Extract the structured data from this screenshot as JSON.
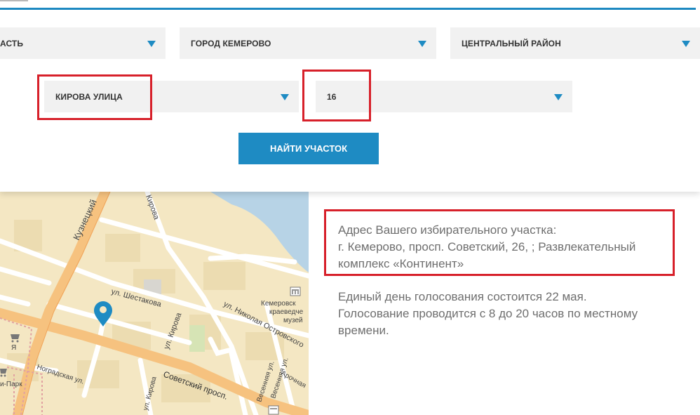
{
  "filters": {
    "region": "АСТЬ",
    "city": "ГОРОД КЕМЕРОВО",
    "district": "ЦЕНТРАЛЬНЫЙ РАЙОН",
    "street": "КИРОВА УЛИЦА",
    "house": "16"
  },
  "search_button": "НАЙТИ УЧАСТОК",
  "result": {
    "line1": "Адрес Вашего избирательного участка:",
    "line2": "г. Кемерово, просп. Советский, 26, ; Развлекательный",
    "line3": "комплекс «Континент»"
  },
  "note": {
    "line1": "Единый день голосования состоится 22 мая.",
    "line2": "Голосование проводится с 8 до 20 часов по местному",
    "line3": "времени."
  },
  "map": {
    "labels": {
      "kuznetsky": "Кузнецкий",
      "kirova_top": "Кирова",
      "shestakova": "ул. Шестакова",
      "kirova_mid": "ул. Кирова",
      "ostrovskogo": "ул. Николая Островского",
      "museum1": "Кемеровск",
      "museum2": "краеведче",
      "museum3": "музей",
      "sovetsky": "Советский просп.",
      "nogradskaya": "Ноградская ул.",
      "kirova_low": "ул. Кирова",
      "vesennyaya1": "Весенняя ул.",
      "vesennyaya2": "Весенняя ул.",
      "arochnaya": "Арочная",
      "park": "и-Парк",
      "ya": "Я"
    },
    "colors": {
      "water": "#b7d3e6",
      "land": "#f4e7c3",
      "road": "#f6c27f",
      "marker": "#1e8bc3"
    }
  }
}
